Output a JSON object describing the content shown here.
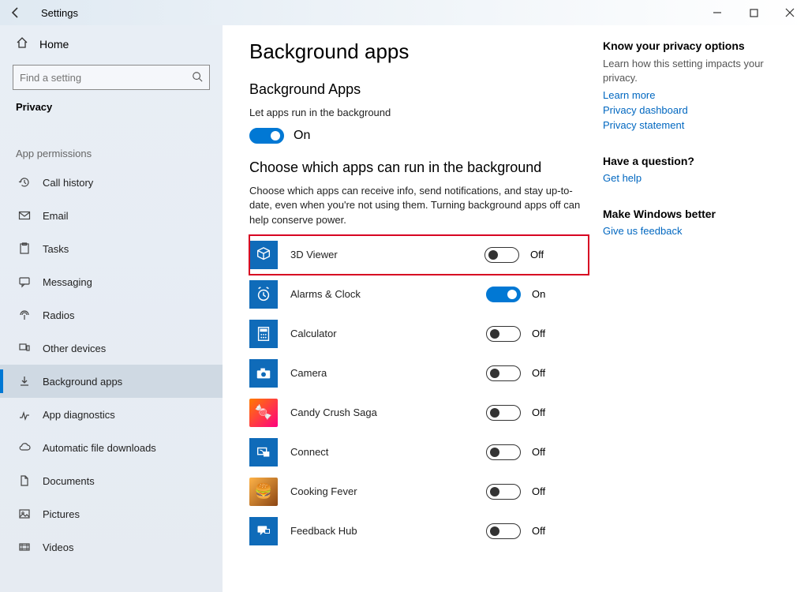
{
  "titlebar": {
    "title": "Settings"
  },
  "sidebar": {
    "home": "Home",
    "search_placeholder": "Find a setting",
    "category": "Privacy",
    "group": "App permissions",
    "items": [
      {
        "label": "Call history"
      },
      {
        "label": "Email"
      },
      {
        "label": "Tasks"
      },
      {
        "label": "Messaging"
      },
      {
        "label": "Radios"
      },
      {
        "label": "Other devices"
      },
      {
        "label": "Background apps"
      },
      {
        "label": "App diagnostics"
      },
      {
        "label": "Automatic file downloads"
      },
      {
        "label": "Documents"
      },
      {
        "label": "Pictures"
      },
      {
        "label": "Videos"
      }
    ]
  },
  "main": {
    "heading": "Background apps",
    "section1_title": "Background Apps",
    "master_label": "Let apps run in the background",
    "master_state": "On",
    "section2_title": "Choose which apps can run in the background",
    "section2_desc": "Choose which apps can receive info, send notifications, and stay up-to-date, even when you're not using them. Turning background apps off can help conserve power.",
    "apps": [
      {
        "name": "3D Viewer",
        "state": "Off"
      },
      {
        "name": "Alarms & Clock",
        "state": "On"
      },
      {
        "name": "Calculator",
        "state": "Off"
      },
      {
        "name": "Camera",
        "state": "Off"
      },
      {
        "name": "Candy Crush Saga",
        "state": "Off"
      },
      {
        "name": "Connect",
        "state": "Off"
      },
      {
        "name": "Cooking Fever",
        "state": "Off"
      },
      {
        "name": "Feedback Hub",
        "state": "Off"
      }
    ]
  },
  "aside": {
    "kyp_title": "Know your privacy options",
    "kyp_desc": "Learn how this setting impacts your privacy.",
    "links1": [
      "Learn more",
      "Privacy dashboard",
      "Privacy statement"
    ],
    "q_title": "Have a question?",
    "q_link": "Get help",
    "mwb_title": "Make Windows better",
    "mwb_link": "Give us feedback"
  }
}
